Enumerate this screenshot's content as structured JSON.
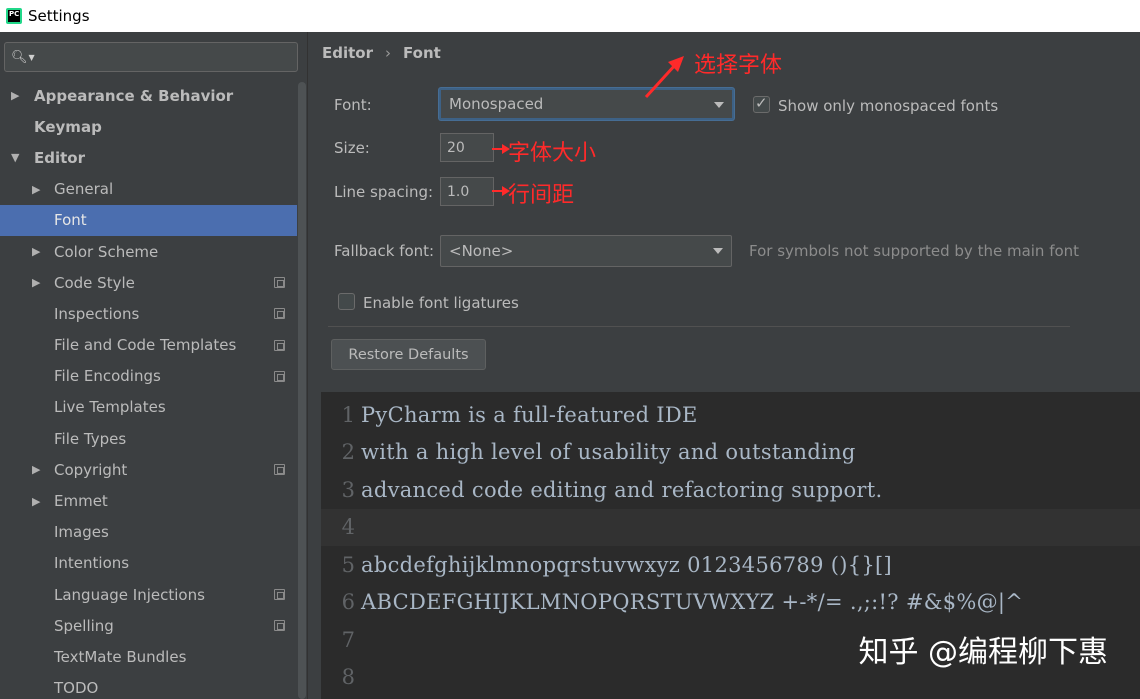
{
  "window": {
    "title": "Settings",
    "app_icon_text": "PC"
  },
  "search": {
    "value": "",
    "placeholder": ""
  },
  "sidebar": {
    "items": [
      {
        "label": "Appearance & Behavior",
        "level": 0,
        "arrow": "▶",
        "bold": true
      },
      {
        "label": "Keymap",
        "level": 0,
        "arrow": "",
        "bold": true
      },
      {
        "label": "Editor",
        "level": 0,
        "arrow": "▼",
        "bold": true
      },
      {
        "label": "General",
        "level": 1,
        "arrow": "▶"
      },
      {
        "label": "Font",
        "level": 1,
        "arrow": "",
        "selected": true
      },
      {
        "label": "Color Scheme",
        "level": 1,
        "arrow": "▶"
      },
      {
        "label": "Code Style",
        "level": 1,
        "arrow": "▶",
        "copy": true
      },
      {
        "label": "Inspections",
        "level": 1,
        "arrow": "",
        "copy": true
      },
      {
        "label": "File and Code Templates",
        "level": 1,
        "arrow": "",
        "copy": true
      },
      {
        "label": "File Encodings",
        "level": 1,
        "arrow": "",
        "copy": true
      },
      {
        "label": "Live Templates",
        "level": 1,
        "arrow": ""
      },
      {
        "label": "File Types",
        "level": 1,
        "arrow": ""
      },
      {
        "label": "Copyright",
        "level": 1,
        "arrow": "▶",
        "copy": true
      },
      {
        "label": "Emmet",
        "level": 1,
        "arrow": "▶"
      },
      {
        "label": "Images",
        "level": 1,
        "arrow": ""
      },
      {
        "label": "Intentions",
        "level": 1,
        "arrow": ""
      },
      {
        "label": "Language Injections",
        "level": 1,
        "arrow": "",
        "copy": true
      },
      {
        "label": "Spelling",
        "level": 1,
        "arrow": "",
        "copy": true
      },
      {
        "label": "TextMate Bundles",
        "level": 1,
        "arrow": ""
      },
      {
        "label": "TODO",
        "level": 1,
        "arrow": ""
      }
    ]
  },
  "breadcrumb": {
    "part1": "Editor",
    "separator": "›",
    "part2": "Font"
  },
  "form": {
    "font_label": "Font:",
    "font_value": "Monospaced",
    "show_mono_label": "Show only monospaced fonts",
    "show_mono_checked": true,
    "size_label": "Size:",
    "size_value": "20",
    "spacing_label": "Line spacing:",
    "spacing_value": "1.0",
    "fallback_label": "Fallback font:",
    "fallback_value": "<None>",
    "fallback_hint": "For symbols not supported by the main font",
    "ligatures_label": "Enable font ligatures",
    "ligatures_checked": false,
    "restore_label": "Restore Defaults"
  },
  "annotations": {
    "font": "选择字体",
    "size": "字体大小",
    "spacing": "行间距"
  },
  "preview": {
    "lines": [
      {
        "num": "1",
        "text": "PyCharm is a full-featured IDE"
      },
      {
        "num": "2",
        "text": "with a high level of usability and outstanding"
      },
      {
        "num": "3",
        "text": "advanced code editing and refactoring support."
      },
      {
        "num": "4",
        "text": ""
      },
      {
        "num": "5",
        "text": "abcdefghijklmnopqrstuvwxyz 0123456789 (){}[]"
      },
      {
        "num": "6",
        "text": "ABCDEFGHIJKLMNOPQRSTUVWXYZ +-*/= .,;:!? #&$%@|^"
      },
      {
        "num": "7",
        "text": ""
      },
      {
        "num": "8",
        "text": ""
      }
    ]
  },
  "watermark": "知乎 @编程柳下惠",
  "colors": {
    "sidebar_selected": "#4b6eaf",
    "annotation_red": "#ff2a2a",
    "editor_bg": "#2b2b2b"
  },
  "icons": {
    "search": "search-icon",
    "tree_expand": "chevron-right-icon",
    "tree_collapse": "chevron-down-icon",
    "project_level": "copy-icon",
    "dropdown": "caret-down-icon"
  }
}
